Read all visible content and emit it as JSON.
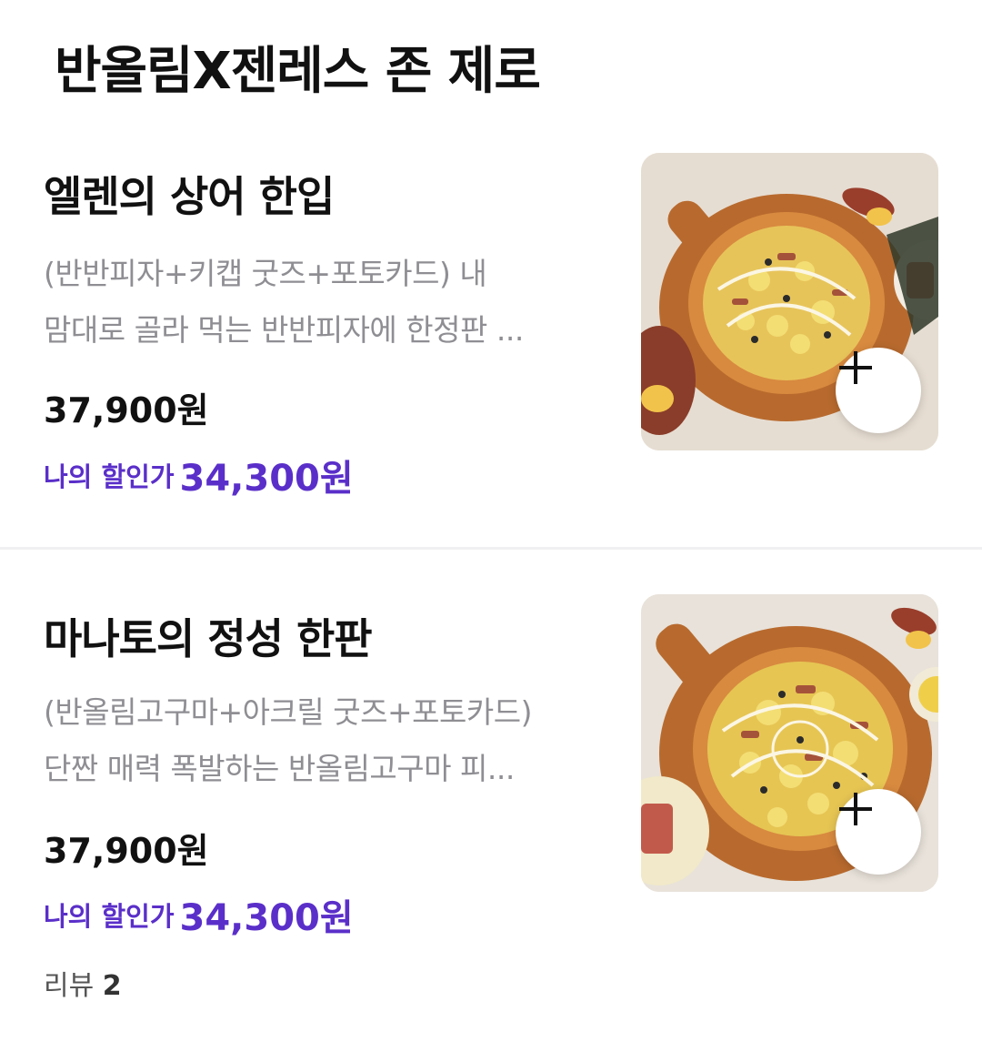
{
  "section": {
    "title": "반올림X젠레스 존 제로"
  },
  "items": [
    {
      "name": "엘렌의 상어 한입",
      "description_lines": [
        "(반반피자+키캡 굿즈+포토카드) 내",
        "맘대로 골라 먹는 반반피자에 한정판 ..."
      ],
      "price": "37,900원",
      "discount_label": "나의 할인가",
      "discount_price": "34,300원",
      "image_icon": "pizza-image",
      "add_icon": "plus-icon"
    },
    {
      "name": "마나토의 정성 한판",
      "description_lines": [
        "(반올림고구마+아크릴 굿즈+포토카드)",
        "단짠 매력 폭발하는 반올림고구마 피..."
      ],
      "price": "37,900원",
      "discount_label": "나의 할인가",
      "discount_price": "34,300원",
      "review_label": "리뷰",
      "review_count": "2",
      "image_icon": "pizza-image",
      "add_icon": "plus-icon"
    }
  ],
  "colors": {
    "discount": "#5a2fc9",
    "description": "#8e8e93",
    "divider": "#f0f0f2"
  }
}
